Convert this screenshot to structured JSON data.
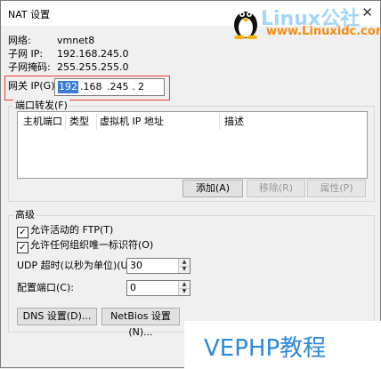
{
  "window": {
    "title": "NAT 设置",
    "close_label": "✕"
  },
  "info": {
    "network_label": "网络:",
    "network_value": "vmnet8",
    "subnet_ip_label": "子网 IP:",
    "subnet_ip_value": "192.168.245.0",
    "subnet_mask_label": "子网掩码:",
    "subnet_mask_value": "255.255.255.0"
  },
  "gateway": {
    "label": "网关 IP(G):",
    "oct1": "192",
    "oct2": ".168",
    "oct3": ".245",
    "oct4": ".  2"
  },
  "port_forwarding": {
    "group_label": "端口转发(F)",
    "columns": [
      "主机端口",
      "类型",
      "虚拟机 IP 地址",
      "描述"
    ],
    "add_label": "添加(A)",
    "remove_label": "移除(R)",
    "properties_label": "属性(P)"
  },
  "advanced": {
    "group_label": "高级",
    "allow_ftp": "允许活动的 FTP(T)",
    "allow_oui": "允许任何组织唯一标识符(O)",
    "checkbox_mark": "✓",
    "udp_label": "UDP 超时(以秒为单位)(U):",
    "udp_value": "30",
    "config_port_label": "配置端口(C):",
    "config_port_value": "0",
    "dns_button": "DNS 设置(D)...",
    "netbios_button": "NetBios 设置(N)..."
  },
  "watermark": {
    "linux_text": "Linux公社",
    "linux_url": "www.Linuxidc.com",
    "vephp": "VEPHP教程"
  },
  "colors": {
    "highlight_border": "#e63a3a",
    "selection": "#3a7bd5",
    "watermark_blue": "#2d8ad8",
    "watermark_orange": "#f58b14"
  }
}
